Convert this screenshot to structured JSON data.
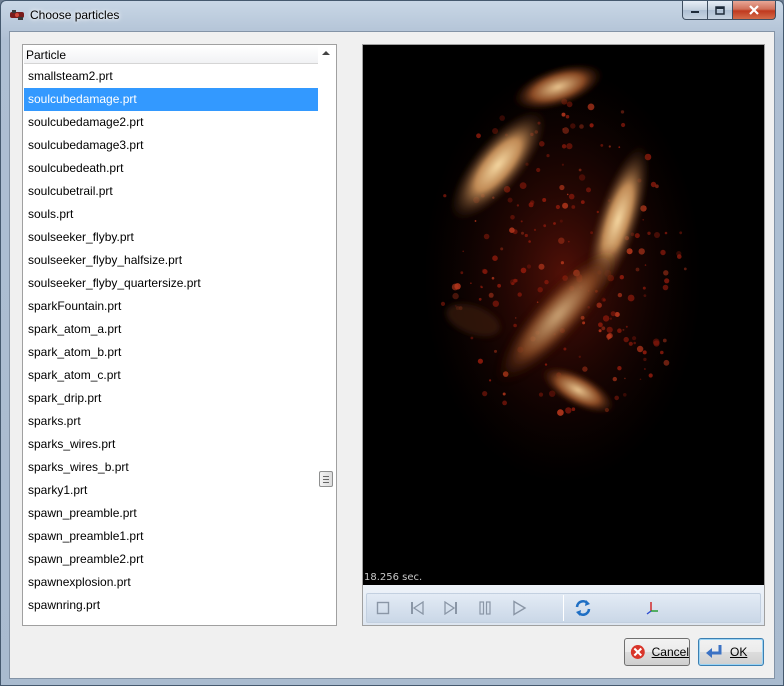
{
  "window": {
    "title": "Choose particles"
  },
  "list": {
    "header": "Particle",
    "selected_index": 1,
    "items": [
      "smallsteam2.prt",
      "soulcubedamage.prt",
      "soulcubedamage2.prt",
      "soulcubedamage3.prt",
      "soulcubedeath.prt",
      "soulcubetrail.prt",
      "souls.prt",
      "soulseeker_flyby.prt",
      "soulseeker_flyby_halfsize.prt",
      "soulseeker_flyby_quartersize.prt",
      "sparkFountain.prt",
      "spark_atom_a.prt",
      "spark_atom_b.prt",
      "spark_atom_c.prt",
      "spark_drip.prt",
      "sparks.prt",
      "sparks_wires.prt",
      "sparks_wires_b.prt",
      "sparky1.prt",
      "spawn_preamble.prt",
      "spawn_preamble1.prt",
      "spawn_preamble2.prt",
      "spawnexplosion.prt",
      "spawnring.prt"
    ]
  },
  "preview": {
    "time": "18.256 sec.",
    "controls": [
      "stop-icon",
      "skip-back-icon",
      "skip-forward-icon",
      "pause-icon",
      "play-icon",
      "loop-icon",
      "axes-icon"
    ]
  },
  "buttons": {
    "cancel": "Cancel",
    "ok": "OK"
  },
  "colors": {
    "selection": "#3399ff",
    "close_button": "#c0391e"
  }
}
